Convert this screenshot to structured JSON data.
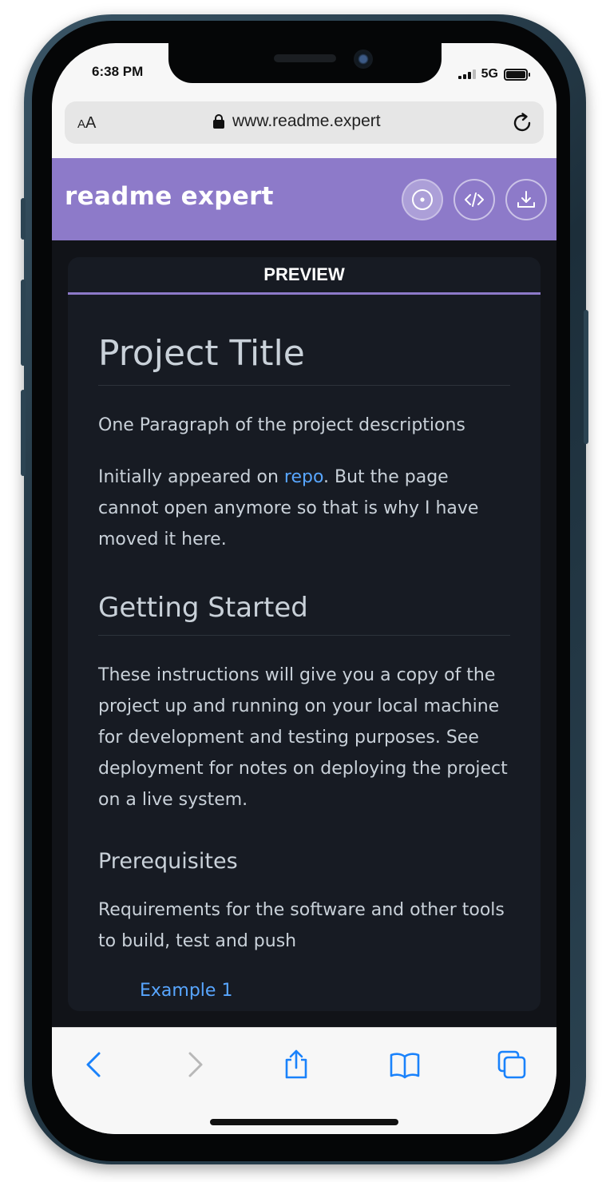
{
  "status_bar": {
    "time": "6:38 PM",
    "network": "5G",
    "battery_level": 1.0
  },
  "browser": {
    "text_size_label_small": "A",
    "text_size_label_large": "A",
    "url": "www.readme.expert"
  },
  "app_header": {
    "title": "readme expert",
    "buttons": [
      {
        "icon": "preview-circle-icon"
      },
      {
        "icon": "code-icon"
      },
      {
        "icon": "download-icon"
      }
    ]
  },
  "preview": {
    "tab_label": "PREVIEW",
    "h1": "Project Title",
    "p1": "One Paragraph of the project descriptions",
    "p2_before_link": "Initially appeared on ",
    "p2_link": "repo",
    "p2_after_link": ". But the page cannot open anymore so that is why I have moved it here.",
    "h2": "Getting Started",
    "p3": "These instructions will give you a copy of the project up and running on your local machine for development and testing purposes. See deployment for notes on deploying the project on a live system.",
    "h3": "Prerequisites",
    "p4": "Requirements for the software and other tools to build, test and push",
    "list_items": [
      "Example 1"
    ]
  },
  "colors": {
    "accent": "#8d7ac9",
    "link": "#58a6ff",
    "preview_bg": "#171b23",
    "text": "#c9d1d9",
    "ios_blue": "#1a82fb"
  }
}
